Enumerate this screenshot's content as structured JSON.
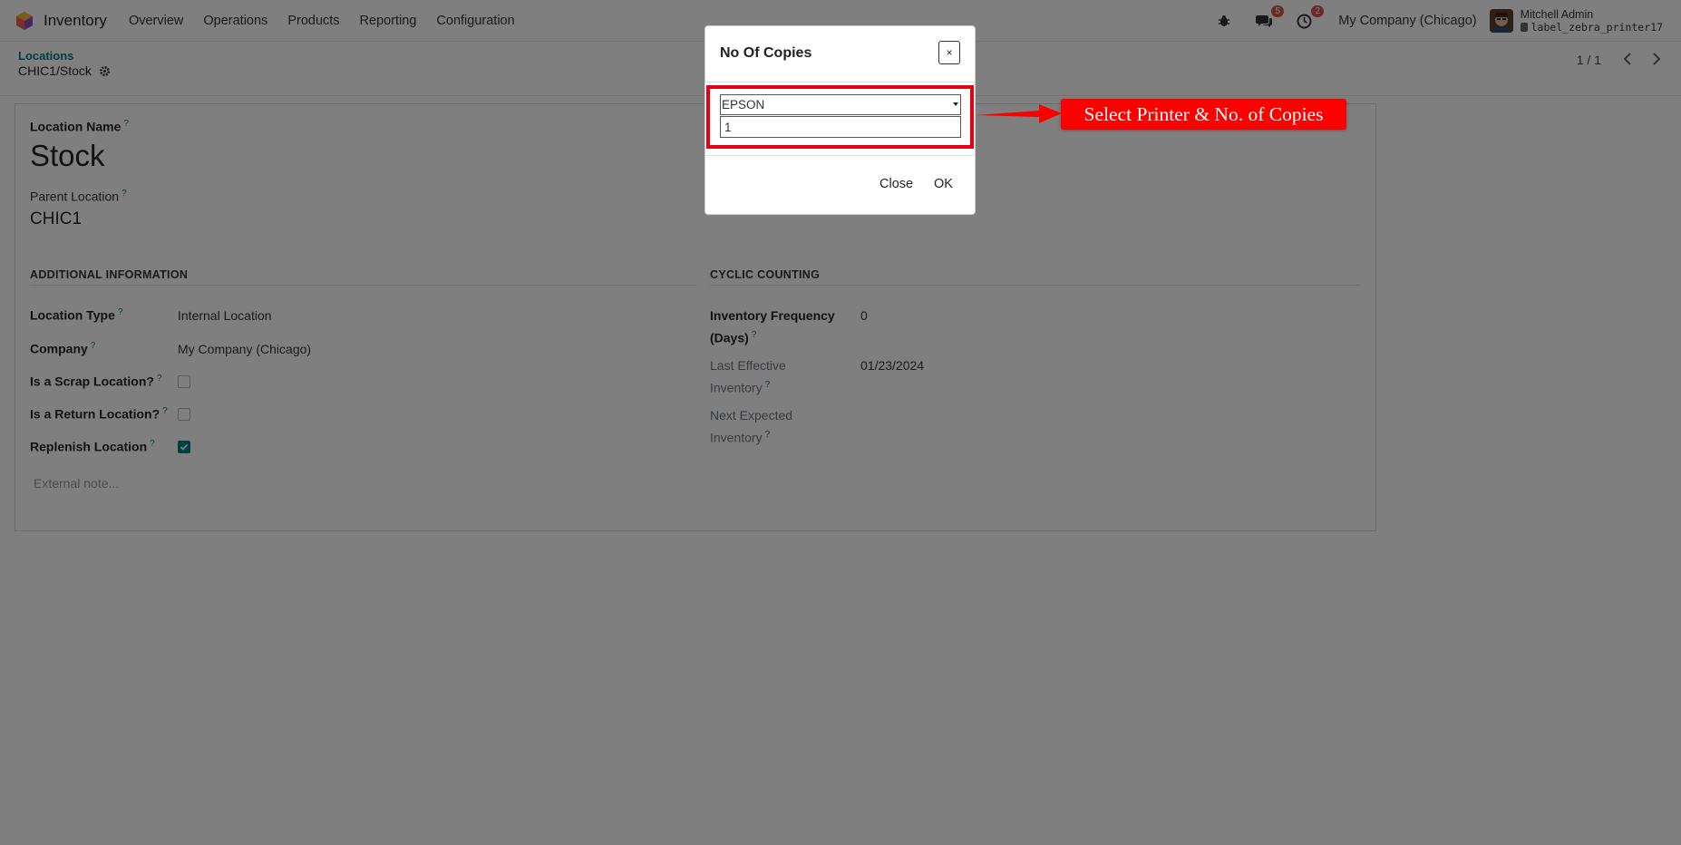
{
  "navbar": {
    "app_name": "Inventory",
    "menus": [
      "Overview",
      "Operations",
      "Products",
      "Reporting",
      "Configuration"
    ],
    "messages_count": "5",
    "activities_count": "2",
    "company": "My Company (Chicago)",
    "user_name": "Mitchell Admin",
    "database": "label_zebra_printer17"
  },
  "breadcrumb": {
    "parent": "Locations",
    "current": "CHIC1/Stock"
  },
  "pager": {
    "value": "1 / 1"
  },
  "form": {
    "location_name_label": "Location Name",
    "location_name": "Stock",
    "parent_location_label": "Parent Location",
    "parent_location": "CHIC1",
    "additional_info_title": "ADDITIONAL INFORMATION",
    "cyclic_counting_title": "CYCLIC COUNTING",
    "location_type_label": "Location Type",
    "location_type": "Internal Location",
    "company_label": "Company",
    "company": "My Company (Chicago)",
    "scrap_label": "Is a Scrap Location?",
    "return_label": "Is a Return Location?",
    "replenish_label": "Replenish Location",
    "inventory_frequency_label_1": "Inventory Frequency",
    "inventory_frequency_label_2": "(Days)",
    "inventory_frequency": "0",
    "last_effective_label_1": "Last Effective",
    "last_effective_label_2": "Inventory",
    "last_effective": "01/23/2024",
    "next_expected_label_1": "Next Expected",
    "next_expected_label_2": "Inventory",
    "external_note_placeholder": "External note..."
  },
  "tooltip_mark": "?",
  "modal": {
    "title": "No Of Copies",
    "close_x": "×",
    "printer": "EPSON",
    "copies": "1",
    "close_label": "Close",
    "ok_label": "OK"
  },
  "annotation": {
    "text": "Select Printer & No. of Copies"
  },
  "colors": {
    "accent": "#017e84",
    "annotation_red": "#ff0000",
    "badge_red": "#d9534f"
  }
}
